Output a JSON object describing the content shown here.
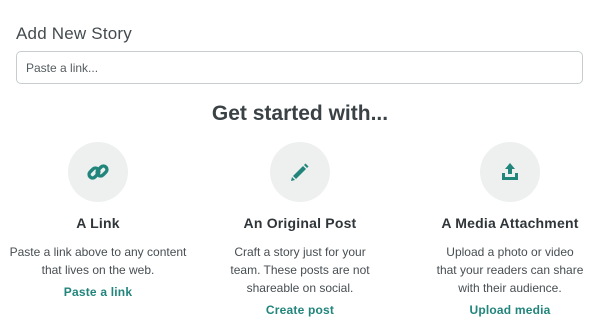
{
  "header": {
    "title": "Add New Story"
  },
  "link_input": {
    "placeholder": "Paste a link...",
    "value": ""
  },
  "section": {
    "title": "Get started with..."
  },
  "accent_color": "#21857c",
  "options": [
    {
      "icon": "link-icon",
      "title": "A Link",
      "description": "Paste a link above to any content that lives on the web.",
      "action": "Paste a link"
    },
    {
      "icon": "pencil-icon",
      "title": "An Original Post",
      "description": "Craft a story just for your team. These posts are not shareable on social.",
      "action": "Create post"
    },
    {
      "icon": "upload-icon",
      "title": "A Media Attachment",
      "description": "Upload a photo or video that your readers can share with their audience.",
      "action": "Upload media"
    }
  ]
}
